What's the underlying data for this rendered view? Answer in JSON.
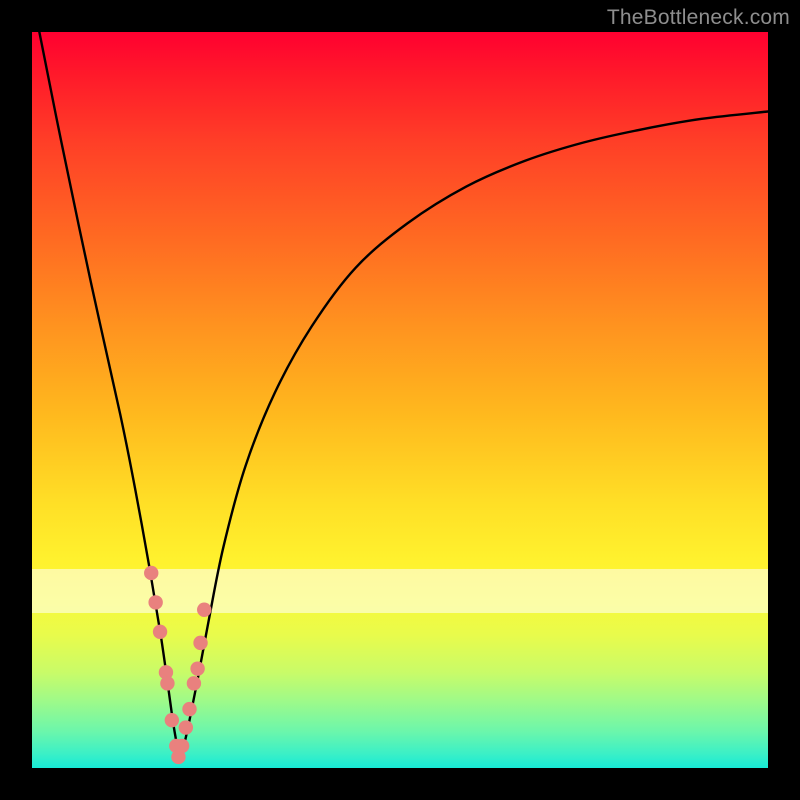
{
  "watermark": "TheBottleneck.com",
  "chart_data": {
    "type": "line",
    "title": "",
    "xlabel": "",
    "ylabel": "",
    "xlim": [
      0,
      100
    ],
    "ylim": [
      0,
      100
    ],
    "grid": false,
    "series": [
      {
        "name": "bottleneck-curve",
        "x": [
          1,
          4,
          8,
          12,
          14,
          16,
          17.5,
          18.5,
          19.2,
          19.8,
          20,
          20.5,
          21.3,
          22.5,
          24,
          26,
          29,
          33,
          38,
          44,
          51,
          59,
          67,
          75,
          83,
          91,
          100
        ],
        "y": [
          100,
          85,
          66,
          48,
          38,
          27,
          18,
          11,
          6,
          2.5,
          1,
          2.5,
          6,
          12,
          20,
          30,
          41,
          51,
          60,
          68,
          74,
          79,
          82.5,
          85,
          86.8,
          88.2,
          89.2
        ]
      }
    ],
    "dot_markers": {
      "name": "highlight-dots",
      "color": "#e9817e",
      "x": [
        16.2,
        16.8,
        17.4,
        18.2,
        18.4,
        19.0,
        19.6,
        19.9,
        20.4,
        20.9,
        21.4,
        22.0,
        22.5,
        22.9,
        23.4
      ],
      "y": [
        26.5,
        22.5,
        18.5,
        13.0,
        11.5,
        6.5,
        3.0,
        1.5,
        3.0,
        5.5,
        8.0,
        11.5,
        13.5,
        17.0,
        21.5
      ]
    },
    "white_band": {
      "y_from": 21,
      "y_to": 27
    }
  }
}
